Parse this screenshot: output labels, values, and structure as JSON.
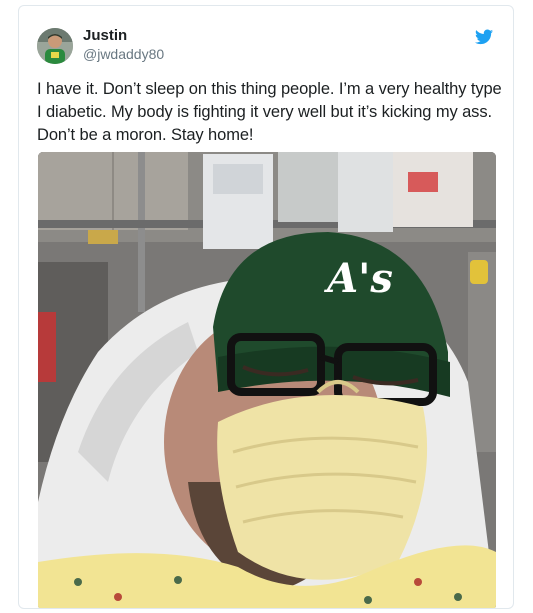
{
  "tweet": {
    "author_name": "Justin",
    "author_handle": "@jwdaddy80",
    "text_lines": [
      "I have it. Don’t sleep on this thing people. I’m a very healthy type",
      "I diabetic. My body is fighting it very well but it’s kicking my ass.",
      "Don’t be a moron. Stay home!"
    ],
    "photo_text": {
      "hat_logo": "A's"
    }
  },
  "icons": {
    "platform": "twitter-bird-icon",
    "avatar": "avatar-photo"
  },
  "colors": {
    "accent": "#1da1f2",
    "text": "#1c2022",
    "muted": "#697882",
    "border": "#e1e8ed",
    "hat_green": "#1f4a2c",
    "mask_yellow": "#efe3a6",
    "gown_yellow": "#f2e493"
  }
}
